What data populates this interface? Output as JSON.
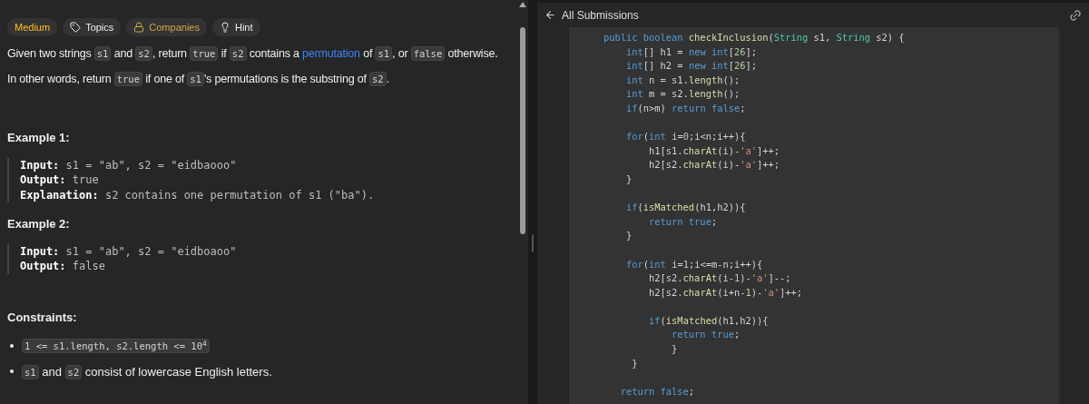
{
  "tags": [
    {
      "label": "Medium",
      "kind": "difficulty"
    },
    {
      "label": "Topics",
      "kind": "tag"
    },
    {
      "label": "Companies",
      "kind": "lock"
    },
    {
      "label": "Hint",
      "kind": "bulb"
    }
  ],
  "description": [
    [
      {
        "kind": "text",
        "text": "Given two strings "
      },
      {
        "kind": "code",
        "text": "s1"
      },
      {
        "kind": "text",
        "text": " and "
      },
      {
        "kind": "code",
        "text": "s2"
      },
      {
        "kind": "text",
        "text": ", return "
      },
      {
        "kind": "code",
        "text": "true"
      },
      {
        "kind": "text",
        "text": " if "
      },
      {
        "kind": "code",
        "text": "s2"
      },
      {
        "kind": "text",
        "text": " contains a "
      },
      {
        "kind": "link",
        "text": "permutation"
      },
      {
        "kind": "text",
        "text": " of "
      },
      {
        "kind": "code",
        "text": "s1"
      },
      {
        "kind": "text",
        "text": ", or "
      },
      {
        "kind": "code",
        "text": "false"
      },
      {
        "kind": "text",
        "text": " otherwise."
      }
    ],
    [
      {
        "kind": "text",
        "text": "In other words, return "
      },
      {
        "kind": "code",
        "text": "true"
      },
      {
        "kind": "text",
        "text": " if one of "
      },
      {
        "kind": "code",
        "text": "s1"
      },
      {
        "kind": "text",
        "text": "'s permutations is the substring of "
      },
      {
        "kind": "code",
        "text": "s2"
      },
      {
        "kind": "text",
        "text": "."
      }
    ]
  ],
  "examples": [
    {
      "title": "Example 1:",
      "lines": [
        {
          "label": "Input:",
          "value": "s1 = \"ab\", s2 = \"eidbaooo\""
        },
        {
          "label": "Output:",
          "value": "true"
        },
        {
          "label": "Explanation:",
          "value": "s2 contains one permutation of s1 (\"ba\")."
        }
      ]
    },
    {
      "title": "Example 2:",
      "lines": [
        {
          "label": "Input:",
          "value": "s1 = \"ab\", s2 = \"eidboaoo\""
        },
        {
          "label": "Output:",
          "value": "false"
        }
      ]
    }
  ],
  "constraints": {
    "title": "Constraints:",
    "items": [
      [
        {
          "kind": "code",
          "text": "1 <= s1.length, s2.length <= 10$^{4}$"
        }
      ],
      [
        {
          "kind": "code",
          "text": "s1"
        },
        {
          "kind": "text",
          "text": " and "
        },
        {
          "kind": "code",
          "text": "s2"
        },
        {
          "kind": "text",
          "text": " consist of lowercase English letters."
        }
      ]
    ]
  },
  "submission": {
    "back_label": "All Submissions",
    "code": [
      {
        "kind": "code",
        "tokens": [
          {
            "kind": "kw",
            "text": "    public boolean "
          },
          {
            "kind": "fn",
            "text": "checkInclusion"
          },
          {
            "kind": "plain",
            "text": "("
          },
          {
            "kind": "type",
            "text": "String"
          },
          {
            "kind": "plain",
            "text": " s1, "
          },
          {
            "kind": "type",
            "text": "String"
          },
          {
            "kind": "plain",
            "text": " s2) {"
          }
        ]
      },
      {
        "kind": "code",
        "tokens": [
          {
            "kind": "kw",
            "text": "        int"
          },
          {
            "kind": "plain",
            "text": "[] h1 = "
          },
          {
            "kind": "kw",
            "text": "new int"
          },
          {
            "kind": "plain",
            "text": "["
          },
          {
            "kind": "num",
            "text": "26"
          },
          {
            "kind": "plain",
            "text": "];"
          }
        ]
      },
      {
        "kind": "code",
        "tokens": [
          {
            "kind": "kw",
            "text": "        int"
          },
          {
            "kind": "plain",
            "text": "[] h2 = "
          },
          {
            "kind": "kw",
            "text": "new int"
          },
          {
            "kind": "plain",
            "text": "["
          },
          {
            "kind": "num",
            "text": "26"
          },
          {
            "kind": "plain",
            "text": "];"
          }
        ]
      },
      {
        "kind": "code",
        "tokens": [
          {
            "kind": "kw",
            "text": "        int"
          },
          {
            "kind": "plain",
            "text": " n = s1."
          },
          {
            "kind": "fn",
            "text": "length"
          },
          {
            "kind": "plain",
            "text": "();"
          }
        ]
      },
      {
        "kind": "code",
        "tokens": [
          {
            "kind": "kw",
            "text": "        int"
          },
          {
            "kind": "plain",
            "text": " m = s2."
          },
          {
            "kind": "fn",
            "text": "length"
          },
          {
            "kind": "plain",
            "text": "();"
          }
        ]
      },
      {
        "kind": "code",
        "tokens": [
          {
            "kind": "kw",
            "text": "        if"
          },
          {
            "kind": "plain",
            "text": "(n>m) "
          },
          {
            "kind": "kw",
            "text": "return false"
          },
          {
            "kind": "plain",
            "text": ";"
          }
        ]
      },
      {
        "kind": "blank"
      },
      {
        "kind": "code",
        "tokens": [
          {
            "kind": "kw",
            "text": "        for"
          },
          {
            "kind": "plain",
            "text": "("
          },
          {
            "kind": "kw",
            "text": "int"
          },
          {
            "kind": "plain",
            "text": " i="
          },
          {
            "kind": "num",
            "text": "0"
          },
          {
            "kind": "plain",
            "text": ";i<n;i++){"
          }
        ]
      },
      {
        "kind": "code",
        "tokens": [
          {
            "kind": "plain",
            "text": "            h1[s1."
          },
          {
            "kind": "fn",
            "text": "charAt"
          },
          {
            "kind": "plain",
            "text": "(i)-"
          },
          {
            "kind": "str",
            "text": "'a'"
          },
          {
            "kind": "plain",
            "text": "]++;"
          }
        ]
      },
      {
        "kind": "code",
        "tokens": [
          {
            "kind": "plain",
            "text": "            h2[s2."
          },
          {
            "kind": "fn",
            "text": "charAt"
          },
          {
            "kind": "plain",
            "text": "(i)-"
          },
          {
            "kind": "str",
            "text": "'a'"
          },
          {
            "kind": "plain",
            "text": "]++;"
          }
        ]
      },
      {
        "kind": "code",
        "tokens": [
          {
            "kind": "plain",
            "text": "        }"
          }
        ]
      },
      {
        "kind": "blank"
      },
      {
        "kind": "code",
        "tokens": [
          {
            "kind": "kw",
            "text": "        if"
          },
          {
            "kind": "plain",
            "text": "("
          },
          {
            "kind": "fn",
            "text": "isMatched"
          },
          {
            "kind": "plain",
            "text": "(h1,h2)){"
          }
        ]
      },
      {
        "kind": "code",
        "tokens": [
          {
            "kind": "kw",
            "text": "            return true"
          },
          {
            "kind": "plain",
            "text": ";"
          }
        ]
      },
      {
        "kind": "code",
        "tokens": [
          {
            "kind": "plain",
            "text": "        }"
          }
        ]
      },
      {
        "kind": "blank"
      },
      {
        "kind": "code",
        "tokens": [
          {
            "kind": "kw",
            "text": "        for"
          },
          {
            "kind": "plain",
            "text": "("
          },
          {
            "kind": "kw",
            "text": "int"
          },
          {
            "kind": "plain",
            "text": " i="
          },
          {
            "kind": "num",
            "text": "1"
          },
          {
            "kind": "plain",
            "text": ";i<=m-n;i++){"
          }
        ]
      },
      {
        "kind": "code",
        "tokens": [
          {
            "kind": "plain",
            "text": "            h2[s2."
          },
          {
            "kind": "fn",
            "text": "charAt"
          },
          {
            "kind": "plain",
            "text": "(i-"
          },
          {
            "kind": "num",
            "text": "1"
          },
          {
            "kind": "plain",
            "text": ")-"
          },
          {
            "kind": "str",
            "text": "'a'"
          },
          {
            "kind": "plain",
            "text": "]--;"
          }
        ]
      },
      {
        "kind": "code",
        "tokens": [
          {
            "kind": "plain",
            "text": "            h2[s2."
          },
          {
            "kind": "fn",
            "text": "charAt"
          },
          {
            "kind": "plain",
            "text": "(i+n-"
          },
          {
            "kind": "num",
            "text": "1"
          },
          {
            "kind": "plain",
            "text": ")-"
          },
          {
            "kind": "str",
            "text": "'a'"
          },
          {
            "kind": "plain",
            "text": "]++;"
          }
        ]
      },
      {
        "kind": "blank"
      },
      {
        "kind": "code",
        "tokens": [
          {
            "kind": "kw",
            "text": "            if"
          },
          {
            "kind": "plain",
            "text": "("
          },
          {
            "kind": "fn",
            "text": "isMatched"
          },
          {
            "kind": "plain",
            "text": "(h1,h2)){"
          }
        ]
      },
      {
        "kind": "code",
        "tokens": [
          {
            "kind": "kw",
            "text": "                return true"
          },
          {
            "kind": "plain",
            "text": ";"
          }
        ]
      },
      {
        "kind": "code",
        "tokens": [
          {
            "kind": "plain",
            "text": "                }"
          }
        ]
      },
      {
        "kind": "code",
        "tokens": [
          {
            "kind": "plain",
            "text": "         }"
          }
        ]
      },
      {
        "kind": "blank"
      },
      {
        "kind": "code",
        "tokens": [
          {
            "kind": "kw",
            "text": "       return false"
          },
          {
            "kind": "plain",
            "text": ";"
          }
        ]
      }
    ]
  }
}
